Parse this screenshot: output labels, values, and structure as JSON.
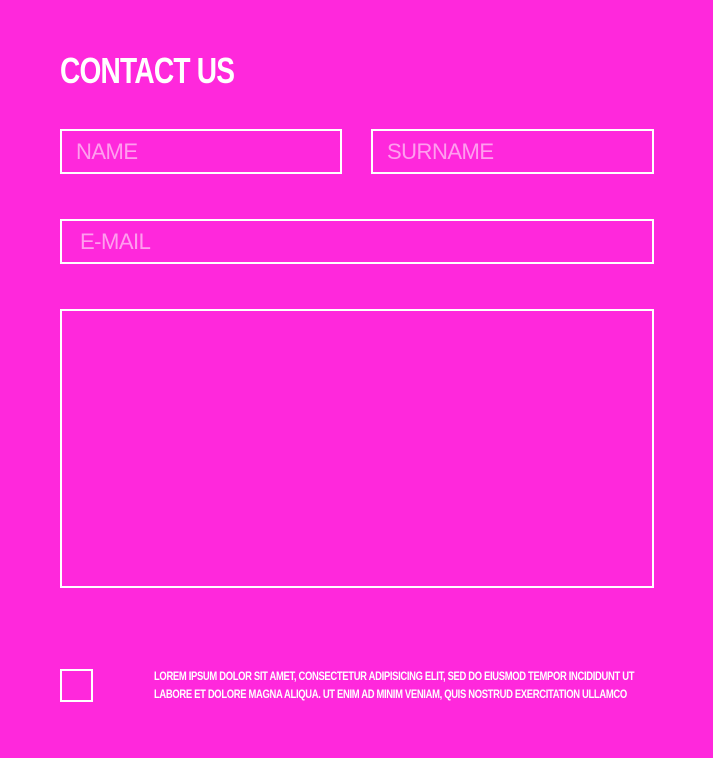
{
  "form": {
    "title": "CONTACT US",
    "name_placeholder": "NAME",
    "surname_placeholder": "SURNAME",
    "email_placeholder": "E-MAIL",
    "message_value": "",
    "consent_text": "LOREM IPSUM DOLOR SIT AMET, CONSECTETUR ADIPISICING ELIT, SED DO EIUSMOD TEMPOR INCIDIDUNT UT LABORE ET DOLORE MAGNA ALIQUA. UT ENIM AD MINIM VENIAM, QUIS NOSTRUD EXERCITATION ULLAMCO",
    "consent_checked": false
  },
  "colors": {
    "background": "#ff28dc",
    "foreground": "#ffffff"
  }
}
